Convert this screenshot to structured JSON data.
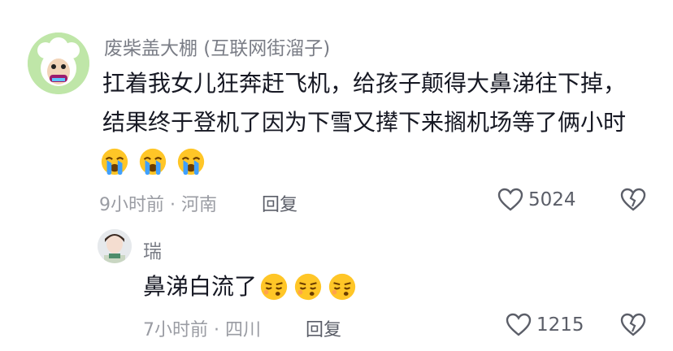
{
  "comment": {
    "username": "废柴盖大棚 (互联网街溜子)",
    "lines": [
      "扛着我女儿狂奔赶飞机，给孩子颠得大鼻涕往下掉，",
      "结果终于登机了因为下雪又撵下来搁机场等了俩小时"
    ],
    "emojis": [
      "crying-face",
      "crying-face",
      "crying-face"
    ],
    "time_location": "9小时前 · 河南",
    "reply_label": "回复",
    "like_count": "5024",
    "icons": [
      "heart-outline-icon",
      "broken-heart-icon"
    ]
  },
  "reply": {
    "username": "瑞",
    "text": "鼻涕白流了",
    "emojis": [
      "smirk-face",
      "smirk-face",
      "smirk-face"
    ],
    "time_location": "7小时前 · 四川",
    "reply_label": "回复",
    "like_count": "1215",
    "icons": [
      "heart-outline-icon",
      "broken-heart-icon"
    ]
  },
  "colors": {
    "text_primary": "#161823",
    "text_secondary": "#9a9ca3",
    "username": "#7a7d86",
    "emoji_yellow": "#ffc627"
  }
}
